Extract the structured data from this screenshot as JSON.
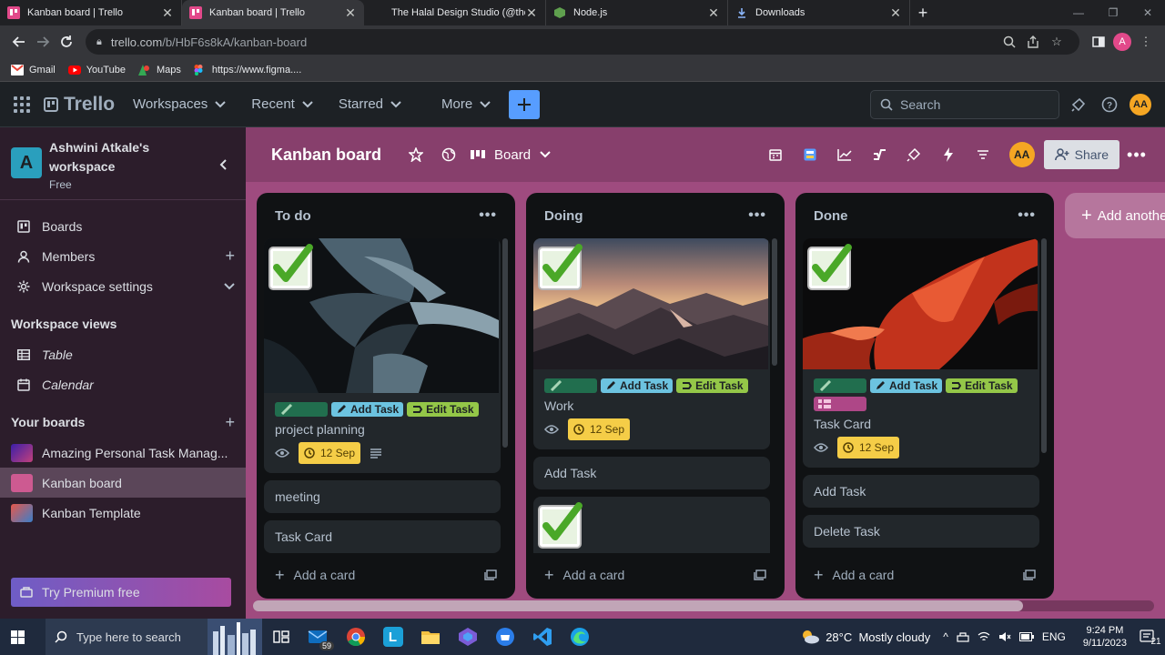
{
  "browser": {
    "tabs": [
      {
        "title": "Kanban board | Trello",
        "active": false
      },
      {
        "title": "Kanban board | Trello",
        "active": true
      },
      {
        "title": "The Halal Design Studio (@theha",
        "active": false
      },
      {
        "title": "Node.js",
        "active": false
      },
      {
        "title": "Downloads",
        "active": false
      }
    ],
    "url_host": "trello.com",
    "url_path": "/b/HbF6s8kA/kanban-board",
    "profile_initial": "A",
    "bookmarks": [
      "Gmail",
      "YouTube",
      "Maps",
      "https://www.figma...."
    ]
  },
  "trello_header": {
    "logo": "Trello",
    "menus": [
      "Workspaces",
      "Recent",
      "Starred",
      "More"
    ],
    "search_placeholder": "Search",
    "avatar": "AA"
  },
  "sidebar": {
    "workspace_initial": "A",
    "workspace_name": "Ashwini Atkale's workspace",
    "workspace_plan": "Free",
    "items": [
      "Boards",
      "Members",
      "Workspace settings"
    ],
    "views_heading": "Workspace views",
    "views": [
      "Table",
      "Calendar"
    ],
    "boards_heading": "Your boards",
    "boards": [
      "Amazing Personal Task Manag...",
      "Kanban board",
      "Kanban Template"
    ],
    "premium": "Try Premium free"
  },
  "board": {
    "title": "Kanban board",
    "view": "Board",
    "avatar": "AA",
    "share": "Share",
    "add_list": "Add another list",
    "add_card": "Add a card",
    "lists": [
      {
        "name": "To do",
        "cover_card": {
          "labels": [
            "Add Task",
            "Edit Task"
          ],
          "title": "project planning",
          "due": "12 Sep"
        },
        "cards": [
          "meeting",
          "Task Card"
        ]
      },
      {
        "name": "Doing",
        "cover_card": {
          "labels": [
            "Add Task",
            "Edit Task"
          ],
          "title": "Work",
          "due": "12 Sep"
        },
        "cards": [
          "Add Task"
        ]
      },
      {
        "name": "Done",
        "cover_card": {
          "labels": [
            "Add Task",
            "Edit Task"
          ],
          "title": "Task Card",
          "due": "12 Sep"
        },
        "cards": [
          "Add Task",
          "Delete Task"
        ]
      }
    ]
  },
  "taskbar": {
    "search_placeholder": "Type here to search",
    "mail_badge": "59",
    "weather": "28°C  Mostly cloudy",
    "lang": "ENG",
    "time": "9:24 PM",
    "date": "9/11/2023",
    "notifications": "21"
  }
}
